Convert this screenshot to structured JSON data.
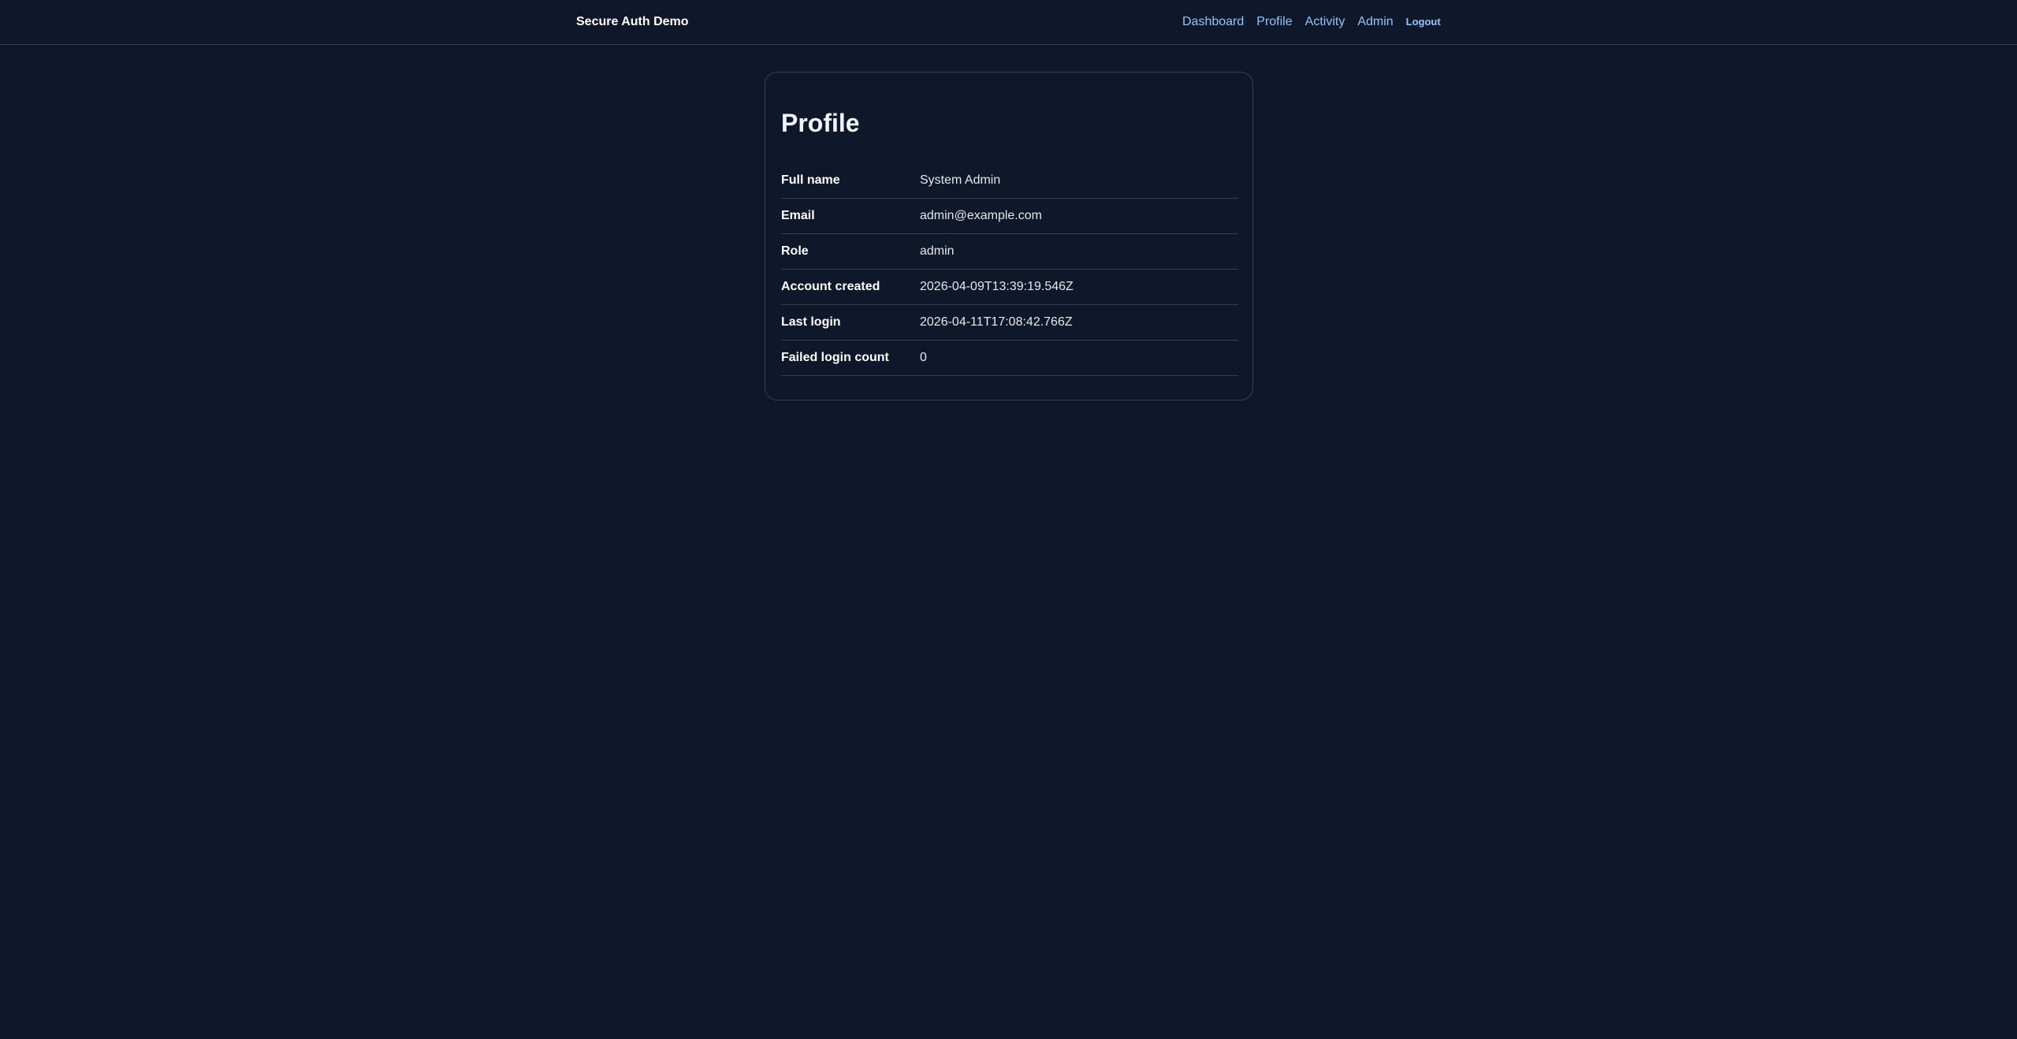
{
  "header": {
    "brand": "Secure Auth Demo",
    "nav": [
      {
        "label": "Dashboard"
      },
      {
        "label": "Profile"
      },
      {
        "label": "Activity"
      },
      {
        "label": "Admin"
      }
    ],
    "logout_label": "Logout"
  },
  "profile": {
    "title": "Profile",
    "rows": [
      {
        "label": "Full name",
        "value": "System Admin"
      },
      {
        "label": "Email",
        "value": "admin@example.com"
      },
      {
        "label": "Role",
        "value": "admin"
      },
      {
        "label": "Account created",
        "value": "2026-04-09T13:39:19.546Z"
      },
      {
        "label": "Last login",
        "value": "2026-04-11T17:08:42.766Z"
      },
      {
        "label": "Failed login count",
        "value": "0"
      }
    ]
  },
  "colors": {
    "background": "#0f172a",
    "link": "#93c5fd",
    "border": "#334155"
  }
}
